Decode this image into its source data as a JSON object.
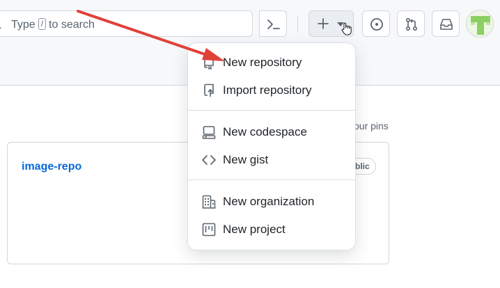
{
  "header": {
    "search_prefix": "Type",
    "search_key": "/",
    "search_suffix": "to search"
  },
  "dashboard": {
    "pins_text": "our pins",
    "repo_name": "image-repo",
    "visibility_badge": "blic"
  },
  "create_menu": {
    "items": [
      {
        "label": "New repository",
        "icon": "repo-icon"
      },
      {
        "label": "Import repository",
        "icon": "repo-push-icon"
      },
      {
        "label": "New codespace",
        "icon": "codespace-icon"
      },
      {
        "label": "New gist",
        "icon": "code-icon"
      },
      {
        "label": "New organization",
        "icon": "organization-icon"
      },
      {
        "label": "New project",
        "icon": "project-icon"
      }
    ]
  },
  "annotation": {
    "arrow_color": "#e0403a"
  },
  "colors": {
    "link": "#0969da",
    "border": "#d0d7de",
    "text": "#1f2328",
    "muted": "#59636e"
  }
}
